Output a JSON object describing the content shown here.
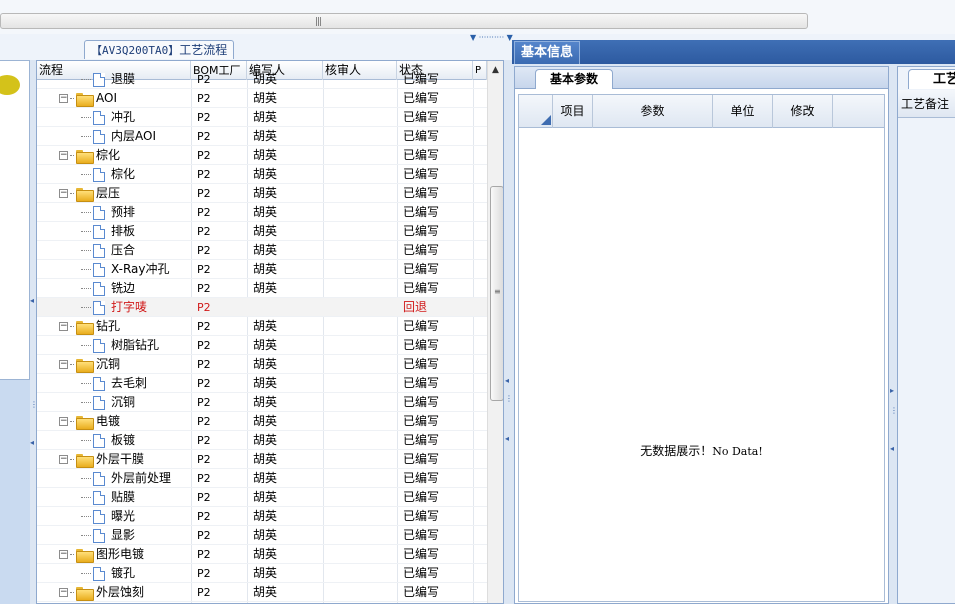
{
  "scrollbar": {
    "grip": "|||"
  },
  "panel_title_lead": "【AV3Q200TA0】",
  "panel_title": "工艺流程",
  "grid": {
    "columns": [
      "流程",
      "BOM工厂",
      "编写人",
      "核审人",
      "状态",
      "P"
    ],
    "rows": [
      {
        "level": 2,
        "type": "doc",
        "name": "退膜",
        "bom": "P2",
        "writer": "胡英",
        "reviewer": "",
        "status": "已编写",
        "selected": false
      },
      {
        "level": 1,
        "type": "folder",
        "name": "AOI",
        "bom": "P2",
        "writer": "胡英",
        "reviewer": "",
        "status": "已编写",
        "selected": false
      },
      {
        "level": 2,
        "type": "doc",
        "name": "冲孔",
        "bom": "P2",
        "writer": "胡英",
        "reviewer": "",
        "status": "已编写",
        "selected": false
      },
      {
        "level": 2,
        "type": "doc",
        "name": "内层AOI",
        "bom": "P2",
        "writer": "胡英",
        "reviewer": "",
        "status": "已编写",
        "selected": false
      },
      {
        "level": 1,
        "type": "folder",
        "name": "棕化",
        "bom": "P2",
        "writer": "胡英",
        "reviewer": "",
        "status": "已编写",
        "selected": false
      },
      {
        "level": 2,
        "type": "doc",
        "name": "棕化",
        "bom": "P2",
        "writer": "胡英",
        "reviewer": "",
        "status": "已编写",
        "selected": false
      },
      {
        "level": 1,
        "type": "folder",
        "name": "层压",
        "bom": "P2",
        "writer": "胡英",
        "reviewer": "",
        "status": "已编写",
        "selected": false
      },
      {
        "level": 2,
        "type": "doc",
        "name": "预排",
        "bom": "P2",
        "writer": "胡英",
        "reviewer": "",
        "status": "已编写",
        "selected": false
      },
      {
        "level": 2,
        "type": "doc",
        "name": "排板",
        "bom": "P2",
        "writer": "胡英",
        "reviewer": "",
        "status": "已编写",
        "selected": false
      },
      {
        "level": 2,
        "type": "doc",
        "name": "压合",
        "bom": "P2",
        "writer": "胡英",
        "reviewer": "",
        "status": "已编写",
        "selected": false
      },
      {
        "level": 2,
        "type": "doc",
        "name": "X-Ray冲孔",
        "bom": "P2",
        "writer": "胡英",
        "reviewer": "",
        "status": "已编写",
        "selected": false
      },
      {
        "level": 2,
        "type": "doc",
        "name": "铣边",
        "bom": "P2",
        "writer": "胡英",
        "reviewer": "",
        "status": "已编写",
        "selected": false
      },
      {
        "level": 2,
        "type": "doc",
        "name": "打字唛",
        "bom": "P2",
        "writer": "",
        "reviewer": "",
        "status": "回退",
        "selected": true
      },
      {
        "level": 1,
        "type": "folder",
        "name": "钻孔",
        "bom": "P2",
        "writer": "胡英",
        "reviewer": "",
        "status": "已编写",
        "selected": false
      },
      {
        "level": 2,
        "type": "doc",
        "name": "树脂钻孔",
        "bom": "P2",
        "writer": "胡英",
        "reviewer": "",
        "status": "已编写",
        "selected": false
      },
      {
        "level": 1,
        "type": "folder",
        "name": "沉铜",
        "bom": "P2",
        "writer": "胡英",
        "reviewer": "",
        "status": "已编写",
        "selected": false
      },
      {
        "level": 2,
        "type": "doc",
        "name": "去毛刺",
        "bom": "P2",
        "writer": "胡英",
        "reviewer": "",
        "status": "已编写",
        "selected": false
      },
      {
        "level": 2,
        "type": "doc",
        "name": "沉铜",
        "bom": "P2",
        "writer": "胡英",
        "reviewer": "",
        "status": "已编写",
        "selected": false
      },
      {
        "level": 1,
        "type": "folder",
        "name": "电镀",
        "bom": "P2",
        "writer": "胡英",
        "reviewer": "",
        "status": "已编写",
        "selected": false
      },
      {
        "level": 2,
        "type": "doc",
        "name": "板镀",
        "bom": "P2",
        "writer": "胡英",
        "reviewer": "",
        "status": "已编写",
        "selected": false
      },
      {
        "level": 1,
        "type": "folder",
        "name": "外层干膜",
        "bom": "P2",
        "writer": "胡英",
        "reviewer": "",
        "status": "已编写",
        "selected": false
      },
      {
        "level": 2,
        "type": "doc",
        "name": "外层前处理",
        "bom": "P2",
        "writer": "胡英",
        "reviewer": "",
        "status": "已编写",
        "selected": false
      },
      {
        "level": 2,
        "type": "doc",
        "name": "贴膜",
        "bom": "P2",
        "writer": "胡英",
        "reviewer": "",
        "status": "已编写",
        "selected": false
      },
      {
        "level": 2,
        "type": "doc",
        "name": "曝光",
        "bom": "P2",
        "writer": "胡英",
        "reviewer": "",
        "status": "已编写",
        "selected": false
      },
      {
        "level": 2,
        "type": "doc",
        "name": "显影",
        "bom": "P2",
        "writer": "胡英",
        "reviewer": "",
        "status": "已编写",
        "selected": false
      },
      {
        "level": 1,
        "type": "folder",
        "name": "图形电镀",
        "bom": "P2",
        "writer": "胡英",
        "reviewer": "",
        "status": "已编写",
        "selected": false
      },
      {
        "level": 2,
        "type": "doc",
        "name": "镀孔",
        "bom": "P2",
        "writer": "胡英",
        "reviewer": "",
        "status": "已编写",
        "selected": false
      },
      {
        "level": 1,
        "type": "folder",
        "name": "外层蚀刻",
        "bom": "P2",
        "writer": "胡英",
        "reviewer": "",
        "status": "已编写",
        "selected": false
      }
    ]
  },
  "detail": {
    "tab_label": "基本信息",
    "subtab_label": "基本参数",
    "param_columns": [
      "项目",
      "参数",
      "单位",
      "修改"
    ],
    "no_data": "无数据展示！",
    "no_data_en": "No Data!",
    "far_tab_label": "工艺",
    "far_subheader": "工艺备注"
  },
  "colors": {
    "accent": "#2d5aa0",
    "selected_text": "#d11a1a",
    "folder": "#e9ad1e"
  }
}
